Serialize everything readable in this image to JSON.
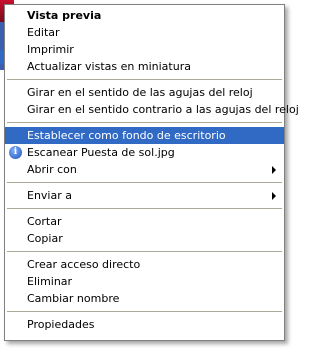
{
  "menu": {
    "groups": [
      [
        {
          "label": "Vista previa",
          "bold": true
        },
        {
          "label": "Editar"
        },
        {
          "label": "Imprimir"
        },
        {
          "label": "Actualizar vistas en miniatura"
        }
      ],
      [
        {
          "label": "Girar en el sentido de las agujas del reloj"
        },
        {
          "label": "Girar en el sentido contrario a las agujas del reloj"
        }
      ],
      [
        {
          "label": "Establecer como fondo de escritorio",
          "highlighted": true
        },
        {
          "label": "Escanear Puesta de sol.jpg",
          "icon": "info-icon"
        },
        {
          "label": "Abrir con",
          "submenu": true
        }
      ],
      [
        {
          "label": "Enviar a",
          "submenu": true
        }
      ],
      [
        {
          "label": "Cortar"
        },
        {
          "label": "Copiar"
        }
      ],
      [
        {
          "label": "Crear acceso directo"
        },
        {
          "label": "Eliminar"
        },
        {
          "label": "Cambiar nombre"
        }
      ],
      [
        {
          "label": "Propiedades"
        }
      ]
    ]
  },
  "colors": {
    "highlight": "#316ac5",
    "separator": "#aca899",
    "border": "#808080"
  }
}
